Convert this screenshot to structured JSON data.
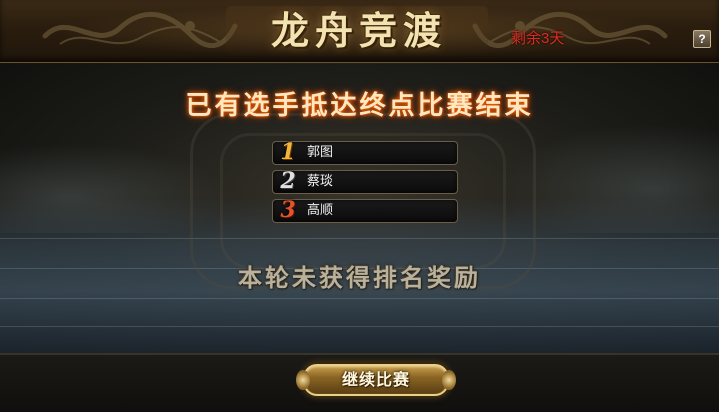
{
  "header": {
    "title": "龙舟竞渡",
    "days_left": "剩余3天",
    "help_label": "?"
  },
  "main": {
    "headline": "已有选手抵达终点比赛结束",
    "rankings": [
      {
        "rank": "1",
        "name": "郭图"
      },
      {
        "rank": "2",
        "name": "蔡琰"
      },
      {
        "rank": "3",
        "name": "高顺"
      }
    ],
    "reward_message": "本轮未获得排名奖励"
  },
  "footer": {
    "continue_label": "继续比赛"
  },
  "colors": {
    "title": "#f3e3b0",
    "days_left": "#e02a20",
    "headline": "#ffe7c2",
    "rank1": "#f0b53a",
    "rank2": "#e0e0e0",
    "rank3": "#e0552a",
    "reward_message": "#b9b19c"
  }
}
